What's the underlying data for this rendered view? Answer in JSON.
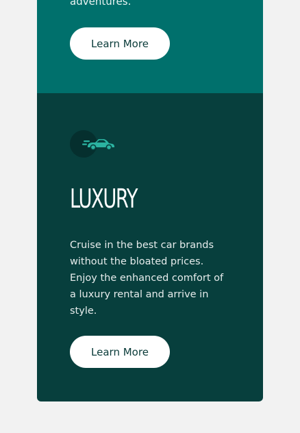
{
  "top_card": {
    "tail_text": "adventures.",
    "button_label": "Learn More"
  },
  "luxury_card": {
    "icon": "sports-car-icon",
    "title": "LUXURY",
    "description": "Cruise in the best car brands without the bloated prices. Enjoy the enhanced comfort of a luxury rental and arrive in style.",
    "button_label": "Learn More"
  },
  "colors": {
    "page_bg": "#f2f2f2",
    "top_card_bg": "#00706c",
    "main_card_bg": "#073f3d",
    "icon_accent": "#2bb3a1",
    "button_bg": "#ffffff",
    "button_text": "#0a3b39"
  }
}
